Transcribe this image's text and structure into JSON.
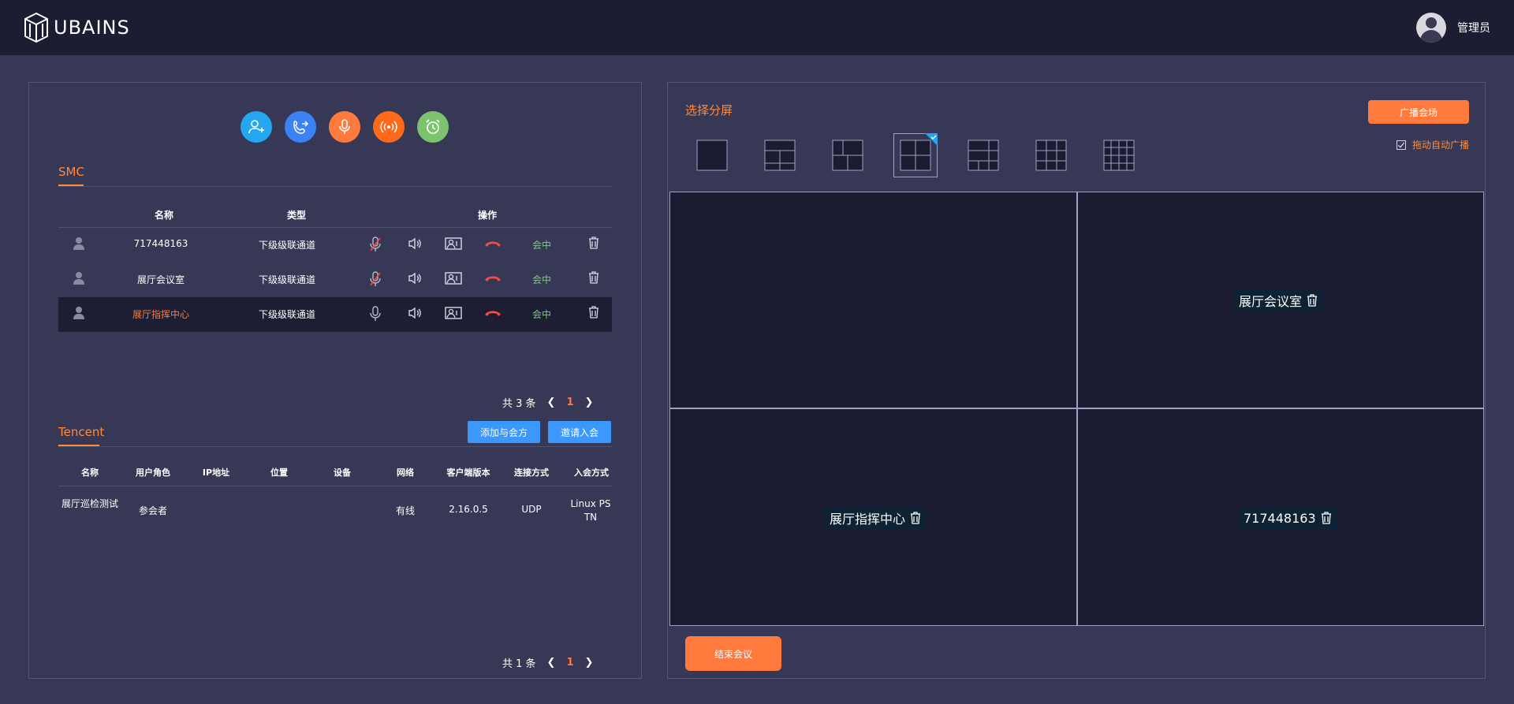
{
  "app": {
    "brand": "UBAINS",
    "user": "管理员"
  },
  "left": {
    "actions": [
      {
        "icon": "add-user-icon",
        "color": "#22a7f0"
      },
      {
        "icon": "call-transfer-icon",
        "color": "#3b82f6"
      },
      {
        "icon": "microphone-icon",
        "color": "#ff7a3c"
      },
      {
        "icon": "broadcast-icon",
        "color": "#ff6a1a"
      },
      {
        "icon": "alarm-clock-icon",
        "color": "#7cc36b"
      }
    ],
    "smc": {
      "tab": "SMC",
      "headers": {
        "name": "名称",
        "type": "类型",
        "ops": "操作"
      },
      "rows": [
        {
          "name": "717448163",
          "type": "下级级联通道",
          "state": "会中",
          "mic_muted": true
        },
        {
          "name": "展厅会议室",
          "type": "下级级联通道",
          "state": "会中",
          "mic_muted": true
        },
        {
          "name": "展厅指挥中心",
          "type": "下级级联通道",
          "state": "会中",
          "mic_muted": false
        }
      ],
      "total": "共 3 条",
      "page": "1"
    },
    "tencent": {
      "tab": "Tencent",
      "add_btn": "添加与会方",
      "invite_btn": "邀请入会",
      "headers": [
        "名称",
        "用户角色",
        "IP地址",
        "位置",
        "设备",
        "网络",
        "客户端版本",
        "连接方式",
        "入会方式"
      ],
      "row": {
        "name": "展厅巡检测试",
        "role": "参会者",
        "ip": "",
        "location": "",
        "device": "",
        "network": "有线",
        "version": "2.16.0.5",
        "conn": "UDP",
        "join": "Linux PSTN"
      },
      "total": "共 1 条",
      "page": "1"
    }
  },
  "right": {
    "title": "选择分屏",
    "broadcast_btn": "广播会场",
    "auto_broadcast": "拖动自动广播",
    "active_layout": 3,
    "cells": {
      "top_right": "展厅会议室",
      "bottom_left": "展厅指挥中心",
      "bottom_right": "717448163"
    },
    "end_btn": "结束会议"
  },
  "colors": {
    "accent": "#ff7a3c",
    "blue": "#3c98ff",
    "ok": "#6fd36f",
    "hangup": "#ff4a3d"
  }
}
